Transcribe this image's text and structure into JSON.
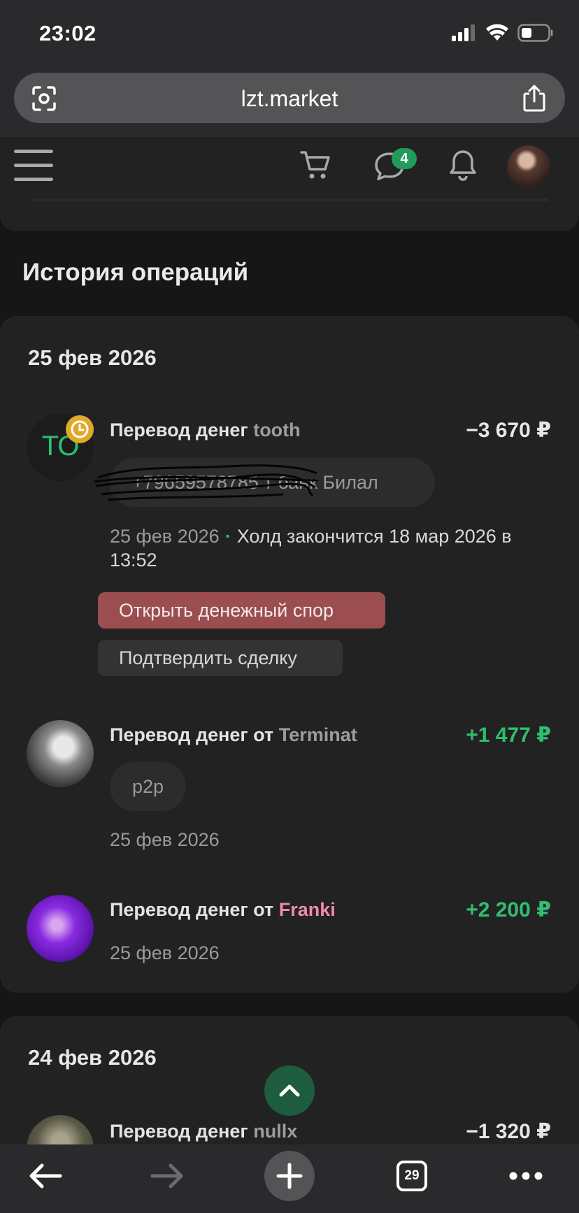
{
  "status_bar": {
    "time": "23:02"
  },
  "browser": {
    "url": "lzt.market",
    "tabs_count": "29"
  },
  "header": {
    "messages_badge": "4"
  },
  "section_title": "История операций",
  "groups": [
    {
      "date": "25 фев 2026",
      "operations": [
        {
          "avatar_text": "TO",
          "title_prefix": "Перевод денег",
          "user": "tooth",
          "amount": "−3 670 ₽",
          "comment": "+79659578785 т банк Билал",
          "date": "25 фев 2026",
          "hold_text": "Холд закончится 18 мар 2026 в 13:52",
          "buttons": {
            "dispute": "Открыть денежный спор",
            "confirm": "Подтвердить сделку"
          }
        },
        {
          "title_prefix": "Перевод денег от",
          "user": "Terminat",
          "amount": "+1 477 ₽",
          "comment": "p2p",
          "date": "25 фев 2026"
        },
        {
          "title_prefix": "Перевод денег от",
          "user": "Franki",
          "amount": "+2 200 ₽",
          "date": "25 фев 2026"
        }
      ]
    },
    {
      "date": "24 фев 2026",
      "operations": [
        {
          "title_prefix": "Перевод денег",
          "user": "nullx",
          "amount": "−1 320 ₽"
        }
      ]
    }
  ],
  "colors": {
    "accent_green": "#2fbf6e",
    "dispute_button": "#9b4d4f",
    "franki_name": "#f08aa6",
    "hold_clock": "#e0a92a"
  },
  "icons": [
    "camera-scan-icon",
    "share-icon",
    "menu-icon",
    "cart-icon",
    "chat-icon",
    "bell-icon",
    "clock-icon",
    "chevron-up-icon",
    "back-arrow-icon",
    "forward-arrow-icon",
    "plus-icon",
    "more-icon"
  ]
}
